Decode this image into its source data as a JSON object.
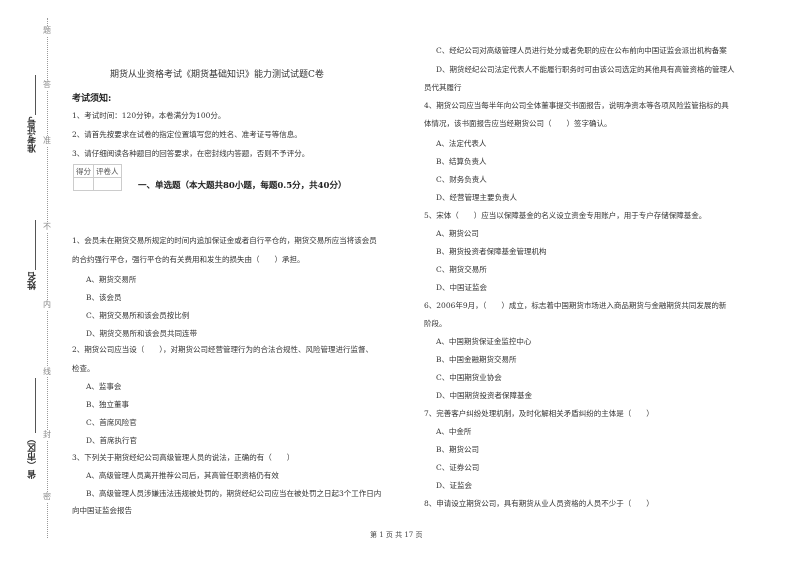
{
  "margin": {
    "seal_chars": [
      "题",
      "答",
      "准",
      "不",
      "内",
      "线",
      "封",
      "密"
    ],
    "fields": [
      "准考证号",
      "姓名",
      "省（市区）"
    ]
  },
  "title": "期货从业资格考试《期货基础知识》能力测试试题C卷",
  "notes": {
    "heading": "考试须知:",
    "items": [
      "1、考试时间：120分钟，本卷满分为100分。",
      "2、请首先按要求在试卷的指定位置填写您的姓名、准考证号等信息。",
      "3、请仔细阅读各种题目的回答要求，在密封线内答题，否则不予评分。"
    ]
  },
  "score_table": {
    "col1": "得分",
    "col2": "评卷人"
  },
  "section_heading": "一、单选题（本大题共80小题，每题0.5分，共40分）",
  "left_column": {
    "q1": {
      "line1": "1、会员未在期货交易所规定的时间内追加保证金或者自行平仓的，期货交易所应当将该会员",
      "line2": "的合约强行平仓，强行平仓的有关费用和发生的损失由（　　）承担。",
      "options": [
        "A、期货交易所",
        "B、该会员",
        "C、期货交易所和该会员按比例",
        "D、期货交易所和该会员共同连带"
      ]
    },
    "q2": {
      "line1": "2、期货公司应当设（　　），对期货公司经营管理行为的合法合规性、风险管理进行监督、",
      "line2": "检查。",
      "options": [
        "A、监事会",
        "B、独立董事",
        "C、首席风险官",
        "D、首席执行官"
      ]
    },
    "q3": {
      "line1": "3、下列关于期货经纪公司高级管理人员的说法，正确的有（　　）",
      "options": [
        "A、高级管理人员离开推荐公司后，其高管任职资格仍有效",
        "B、高级管理人员涉嫌违法违规被处罚的，期货经纪公司应当在被处罚之日起3个工作日内"
      ],
      "cont": "向中国证监会报告"
    }
  },
  "right_column": {
    "q3_rest": {
      "optC": "C、经纪公司对高级管理人员进行处分或者免职的应在公布前向中国证监会派出机构备案",
      "optD1": "D、期货经纪公司法定代表人不能履行职务时可由该公司选定的其他具有高管资格的管理人",
      "optD2": "员代其履行"
    },
    "q4": {
      "line1": "4、期货公司应当每半年向公司全体董事提交书面报告，说明净资本等各项风险监管指标的具",
      "line2": "体情况，该书面报告应当经期货公司（　　）签字确认。",
      "options": [
        "A、法定代表人",
        "B、结算负责人",
        "C、财务负责人",
        "D、经营管理主要负责人"
      ]
    },
    "q5": {
      "line1": "5、宋体（　　）应当以保障基金的名义设立资金专用账户，用于专户存储保障基金。",
      "options": [
        "A、期货公司",
        "B、期货投资者保障基金管理机构",
        "C、期货交易所",
        "D、中国证监会"
      ]
    },
    "q6": {
      "line1": "6、2006年9月，（　　）成立，标志着中国期货市场进入商品期货与金融期货共同发展的新",
      "line2": "阶段。",
      "options": [
        "A、中国期货保证金监控中心",
        "B、中国金融期货交易所",
        "C、中国期货业协会",
        "D、中国期货投资者保障基金"
      ]
    },
    "q7": {
      "line1": "7、完善客户纠纷处理机制，及时化解相关矛盾纠纷的主体是（　　）",
      "options": [
        "A、中金所",
        "B、期货公司",
        "C、证券公司",
        "D、证监会"
      ]
    },
    "q8": {
      "line1": "8、申请设立期货公司，具有期货从业人员资格的人员不少于（　　）"
    }
  },
  "footer": "第 1 页 共 17 页"
}
